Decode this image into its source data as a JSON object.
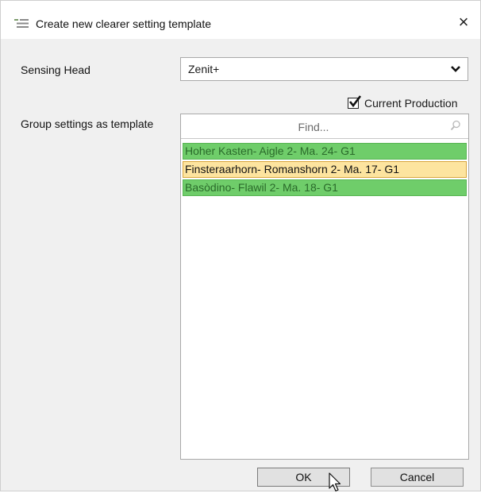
{
  "window": {
    "title": "Create new clearer setting template",
    "close_label": "×"
  },
  "sensing_head": {
    "label": "Sensing Head",
    "value": "Zenit+"
  },
  "current_production": {
    "label": "Current Production",
    "checked": true
  },
  "group_settings": {
    "label": "Group settings as template",
    "find_placeholder": "Find...",
    "items": [
      {
        "text": "Hoher Kasten- Aigle 2- Ma. 24- G1",
        "state": "green"
      },
      {
        "text": "Finsteraarhorn- Romanshorn 2- Ma. 17- G1",
        "state": "selected"
      },
      {
        "text": "Basòdino- Flawil 2- Ma. 18- G1",
        "state": "green"
      }
    ]
  },
  "buttons": {
    "ok": "OK",
    "cancel": "Cancel"
  },
  "colors": {
    "green_item": "#6fcd6a",
    "selected_item": "#fde49f"
  },
  "icons": {
    "app": "window-list-icon",
    "close": "close-icon",
    "dropdown": "chevron-down-icon",
    "find": "search-icon",
    "cursor": "mouse-pointer-icon"
  }
}
